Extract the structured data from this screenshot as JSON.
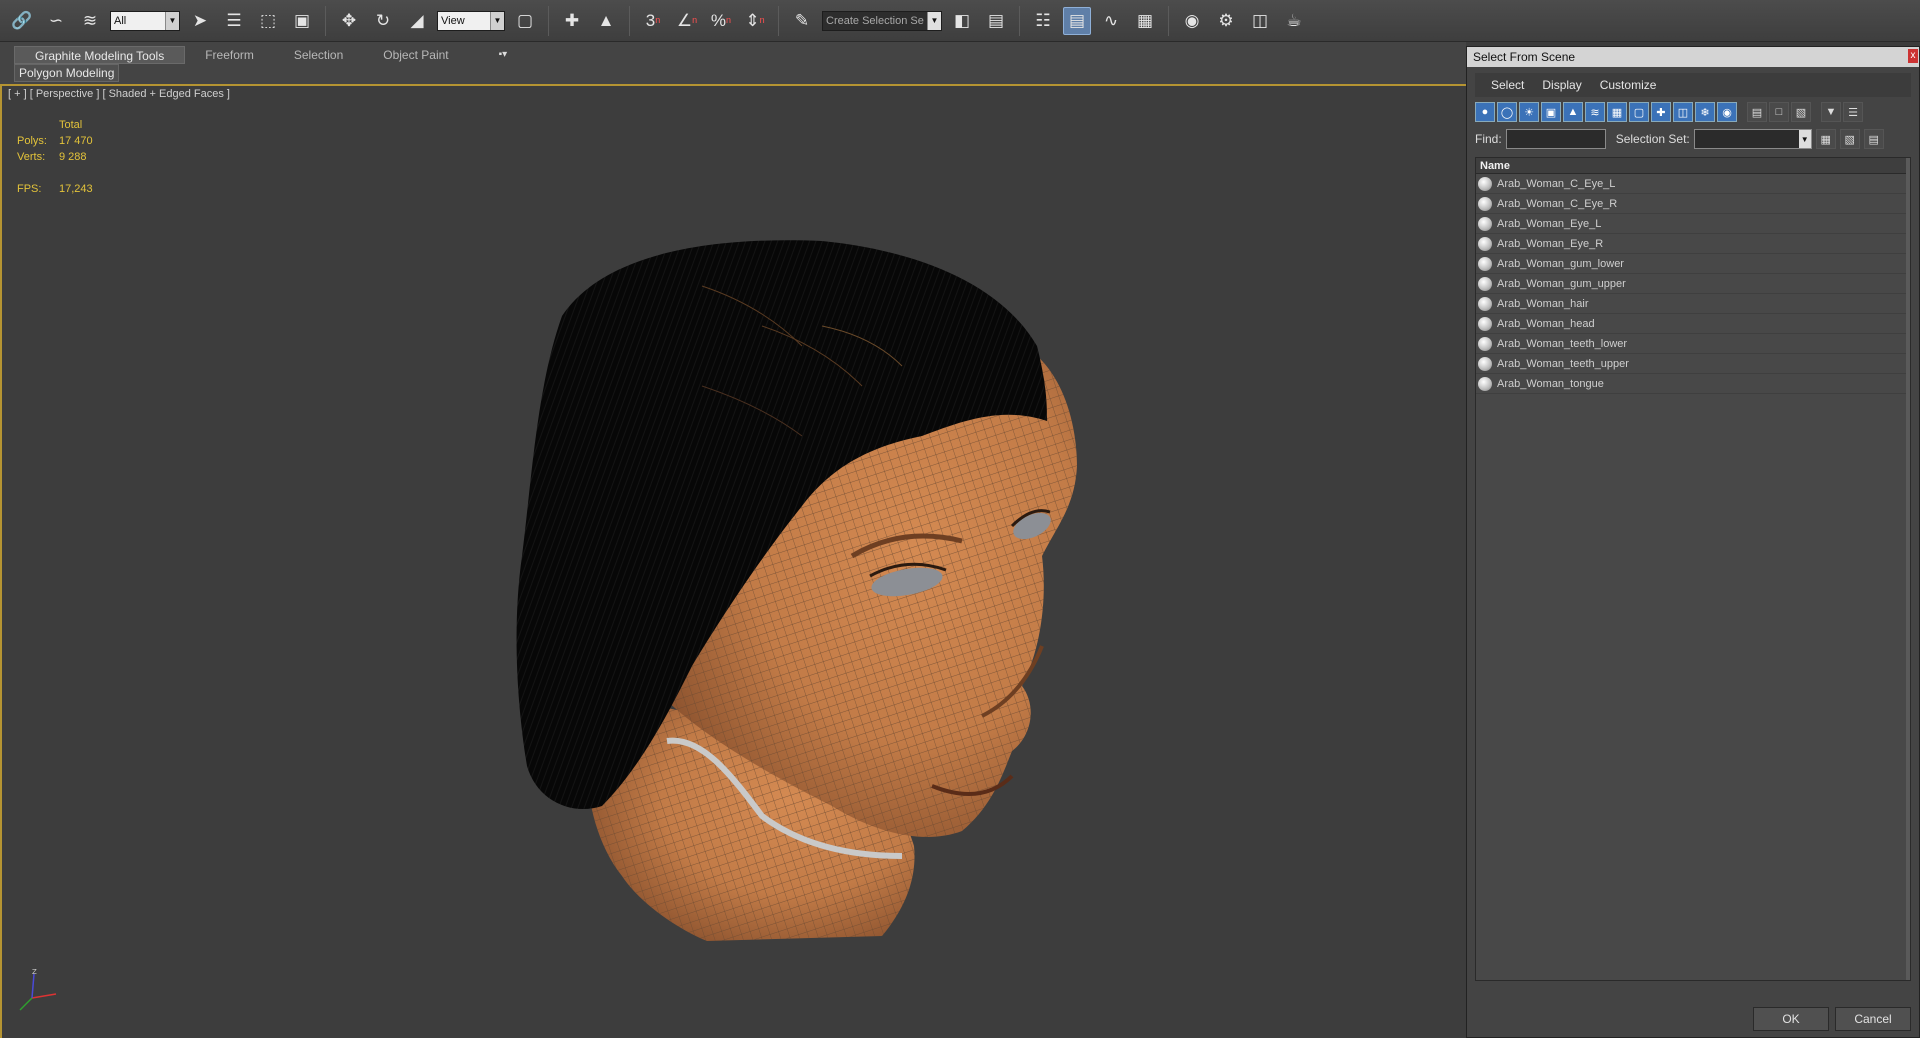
{
  "toolbar": {
    "filter_value": "All",
    "coord_value": "View",
    "named_selection_value": "Create Selection Se",
    "snap_label": "3",
    "icons": [
      "link-icon",
      "unlink-icon",
      "bind-spacewarp-icon",
      "select-object-icon",
      "select-by-name-icon",
      "rect-region-icon",
      "window-crossing-icon",
      "move-icon",
      "rotate-icon",
      "scale-icon",
      "select-manipulate-icon",
      "pivot-icon",
      "keyboard-shortcut-icon",
      "snap-toggle-icon",
      "angle-snap-icon",
      "percent-snap-icon",
      "spinner-snap-icon",
      "edit-named-sets-icon",
      "mirror-icon",
      "align-icon",
      "layer-manager-icon",
      "scene-explorer-icon",
      "curve-editor-icon",
      "schematic-view-icon",
      "material-editor-icon",
      "render-setup-icon",
      "rendered-frame-icon",
      "render-icon"
    ]
  },
  "ribbon": {
    "tabs": [
      "Graphite Modeling Tools",
      "Freeform",
      "Selection",
      "Object Paint"
    ],
    "active_tab": "Graphite Modeling Tools",
    "options_glyph": "▪▾",
    "panel_label": "Polygon Modeling"
  },
  "viewport": {
    "label": "[ + ] [ Perspective ] [ Shaded + Edged Faces ]",
    "stats": {
      "header": "Total",
      "polys_label": "Polys:",
      "polys_value": "17 470",
      "verts_label": "Verts:",
      "verts_value": "9 288",
      "fps_label": "FPS:",
      "fps_value": "17,243"
    },
    "axis": {
      "x": "X",
      "y": "Y",
      "z": "Z"
    },
    "colors": {
      "skin": "#c27b47",
      "hair": "#0a0a0a",
      "background": "#3d3d3d",
      "stats": "#e3c33a"
    }
  },
  "dialog": {
    "title": "Select From Scene",
    "close_glyph": "x",
    "menu": [
      "Select",
      "Display",
      "Customize"
    ],
    "find_label": "Find:",
    "find_value": "",
    "selection_set_label": "Selection Set:",
    "column_header": "Name",
    "items": [
      "Arab_Woman_C_Eye_L",
      "Arab_Woman_C_Eye_R",
      "Arab_Woman_Eye_L",
      "Arab_Woman_Eye_R",
      "Arab_Woman_gum_lower",
      "Arab_Woman_gum_upper",
      "Arab_Woman_hair",
      "Arab_Woman_head",
      "Arab_Woman_teeth_lower",
      "Arab_Woman_teeth_upper",
      "Arab_Woman_tongue"
    ],
    "ok_label": "OK",
    "cancel_label": "Cancel"
  }
}
